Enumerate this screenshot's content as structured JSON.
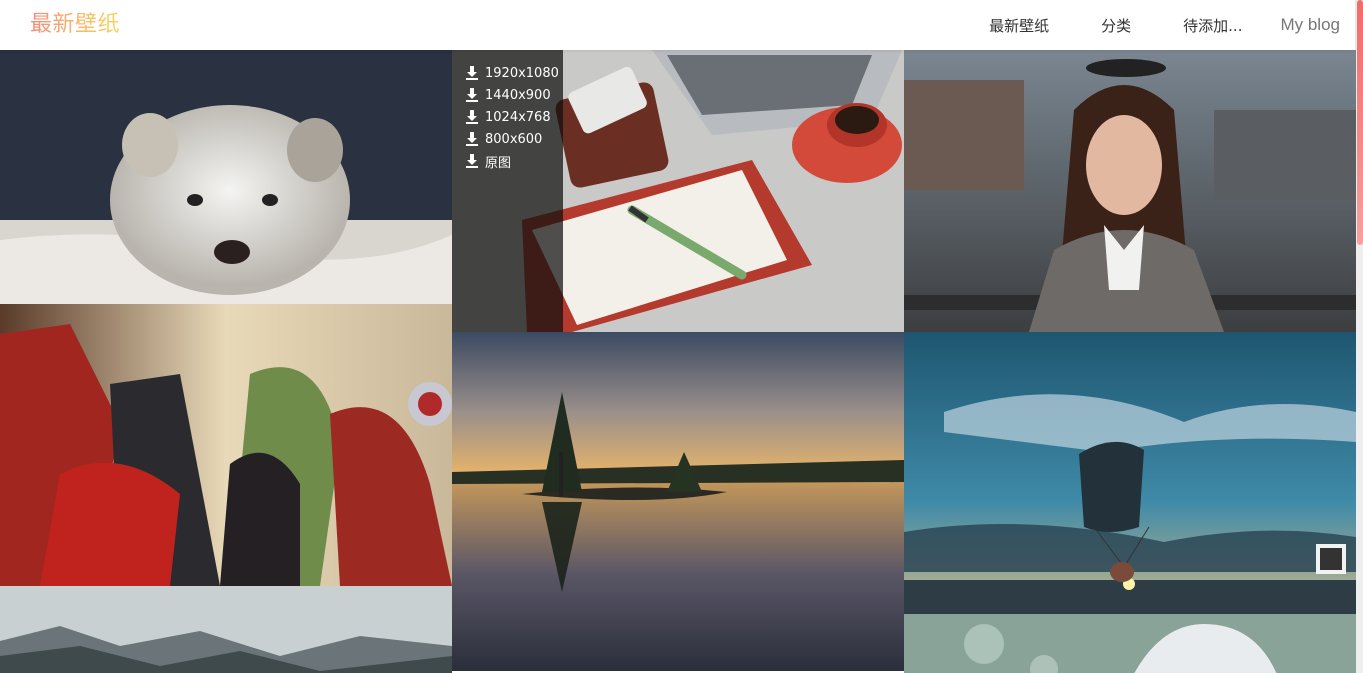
{
  "header": {
    "logo": "最新壁纸",
    "nav": [
      {
        "label": "最新壁纸"
      },
      {
        "label": "分类"
      },
      {
        "label": "待添加..."
      },
      {
        "label": "My blog"
      }
    ]
  },
  "download_menu": [
    {
      "label": "1920x1080"
    },
    {
      "label": "1440x900"
    },
    {
      "label": "1024x768"
    },
    {
      "label": "800x600"
    },
    {
      "label": "原图"
    }
  ],
  "wallpapers": [
    {
      "subject": "husky-puppy"
    },
    {
      "subject": "desk-notebook-laptop-coffee"
    },
    {
      "subject": "woman-in-coat"
    },
    {
      "subject": "avengers-heroes"
    },
    {
      "subject": "lake-sunset-reflection"
    },
    {
      "subject": "paraglider-sky"
    },
    {
      "subject": "misty-mountains"
    },
    {
      "subject": "white-haired-portrait"
    }
  ],
  "colors": {
    "accent": "#f28a7a",
    "accent2": "#f5d75e",
    "scrollbar": "#f26b6b"
  }
}
